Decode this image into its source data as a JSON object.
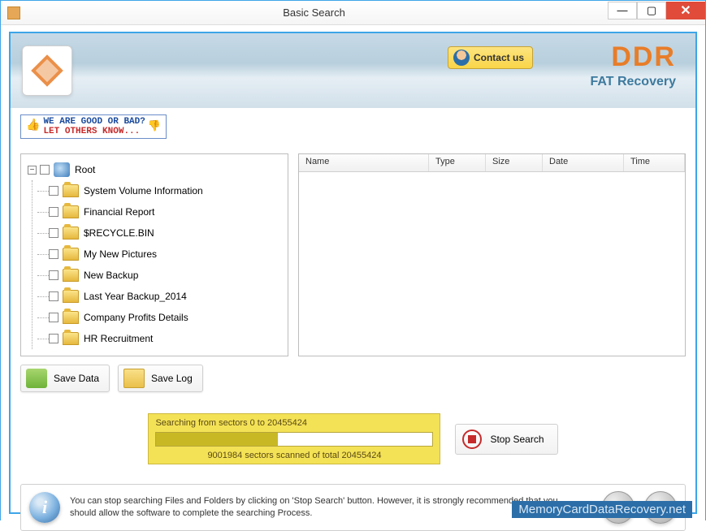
{
  "window": {
    "title": "Basic Search"
  },
  "header": {
    "contact_label": "Contact us",
    "brand": "DDR",
    "brand_sub": "FAT Recovery"
  },
  "feedback": {
    "line1": "WE ARE GOOD OR BAD?",
    "line2": "LET OTHERS KNOW..."
  },
  "tree": {
    "root_label": "Root",
    "items": [
      {
        "label": "System Volume Information"
      },
      {
        "label": "Financial Report"
      },
      {
        "label": "$RECYCLE.BIN"
      },
      {
        "label": "My New Pictures"
      },
      {
        "label": "New Backup"
      },
      {
        "label": "Last Year Backup_2014"
      },
      {
        "label": "Company Profits Details"
      },
      {
        "label": "HR Recruitment"
      }
    ]
  },
  "list": {
    "cols": [
      "Name",
      "Type",
      "Size",
      "Date",
      "Time"
    ]
  },
  "buttons": {
    "save_data": "Save Data",
    "save_log": "Save Log",
    "stop": "Stop Search"
  },
  "progress": {
    "heading": "Searching from sectors 0 to 20455424",
    "scanned": 9001984,
    "total": 20455424,
    "status": "9001984  sectors scanned of total 20455424",
    "percent": 44
  },
  "info": {
    "text": "You can stop searching Files and Folders by clicking on 'Stop Search' button. However, it is strongly recommended that you should allow the software to complete the searching Process."
  },
  "watermark": "MemoryCardDataRecovery.net"
}
